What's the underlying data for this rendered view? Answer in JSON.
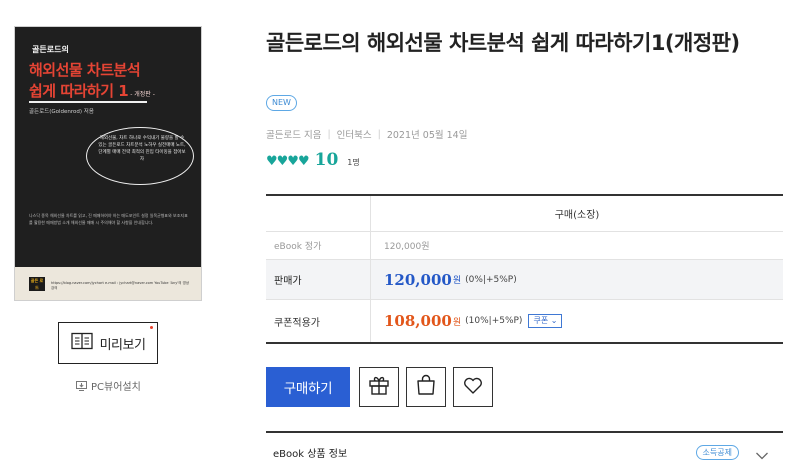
{
  "cover": {
    "publisher_mark": "골든로드의",
    "title_line1": "해외선물 차트분석",
    "title_line2": "쉽게 따라하기 1",
    "edition": "- 개정판 -",
    "author": "골든로드(Goldenrod) 저음",
    "bubble": "해외선물, 차트 하나로 수익내기 물량을 할 수 있는 골든로드 차트분석 노하우 실전매매 노트, 단계별 매매 전략 최적의 진입 타이밍을 잡아보자",
    "body": "나스닥 종목 해외선물 차트를 읽고, 진 매매하여야 하는 매도포인트 설정 일목균형표와 보조지표를 활용한 매매방법 소개 해외선물 매매 시 주의해야 할 사항을 안내합니다.",
    "band_logo": "골든 로드",
    "band_text": "https://blog.naver.com/jychart e-mail : jychart@naver.com YouTube 'Any'의 영상강의 "
  },
  "preview_button": {
    "label": "미리보기"
  },
  "pc_viewer": {
    "label": "PC뷰어설치"
  },
  "product": {
    "title": "골든로드의 해외선물 차트분석 쉽게 따라하기1(개정판)",
    "badge": "NEW",
    "author": "골든로드 지음",
    "publisher": "인터북스",
    "date": "2021년 05월 14일",
    "hearts": "♥♥♥♥",
    "rating": "10",
    "review_count": "1명"
  },
  "price_table": {
    "column_header": "구매(소장)",
    "ebook_label": "eBook 정가",
    "ebook_price": "120,000원",
    "sale_label": "판매가",
    "sale_price": "120,000",
    "sale_unit": "원",
    "sale_discount": "(0%|+5%P)",
    "coupon_label": "쿠폰적용가",
    "coupon_price": "108,000",
    "coupon_unit": "원",
    "coupon_discount": "(10%|+5%P)",
    "coupon_button": "쿠폰"
  },
  "actions": {
    "buy_label": "구매하기"
  },
  "info_bar": {
    "label": "eBook 상품 정보",
    "badge": "소득공제"
  },
  "colors": {
    "accent_blue": "#2a5fd3",
    "rating_green": "#18a59a",
    "coupon_orange": "#e2561a"
  }
}
